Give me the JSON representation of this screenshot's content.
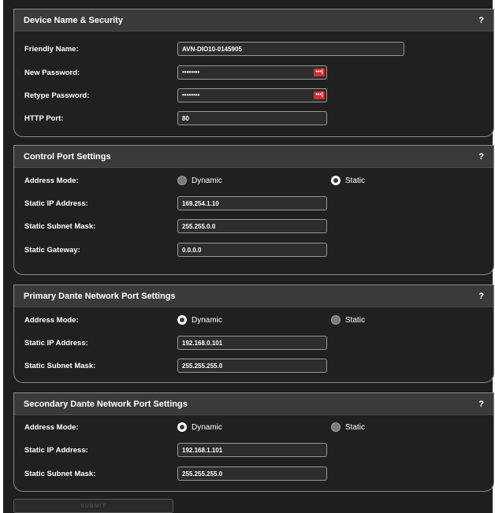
{
  "device": {
    "title": "Device Name & Security",
    "help": "?",
    "friendly_name_label": "Friendly Name:",
    "friendly_name_value": "AVN-DIO10-0145905",
    "new_password_label": "New Password:",
    "new_password_value": "••••••••",
    "retype_password_label": "Retype Password:",
    "retype_password_value": "••••••••",
    "reveal_glyph": "•••|",
    "http_port_label": "HTTP Port:",
    "http_port_value": "80"
  },
  "control": {
    "title": "Control Port Settings",
    "help": "?",
    "address_mode_label": "Address Mode:",
    "dynamic_label": "Dynamic",
    "static_label": "Static",
    "selected_mode": "Static",
    "ip_label": "Static IP Address:",
    "ip_value": "169.254.1.10",
    "mask_label": "Static Subnet Mask:",
    "mask_value": "255.255.0.0",
    "gateway_label": "Static Gateway:",
    "gateway_value": "0.0.0.0"
  },
  "primary": {
    "title": "Primary Dante Network Port Settings",
    "help": "?",
    "address_mode_label": "Address Mode:",
    "dynamic_label": "Dynamic",
    "static_label": "Static",
    "selected_mode": "Dynamic",
    "ip_label": "Static IP Address:",
    "ip_value": "192.168.0.101",
    "mask_label": "Static Subnet Mask:",
    "mask_value": "255.255.255.0"
  },
  "secondary": {
    "title": "Secondary Dante Network Port Settings",
    "help": "?",
    "address_mode_label": "Address Mode:",
    "dynamic_label": "Dynamic",
    "static_label": "Static",
    "selected_mode": "Dynamic",
    "ip_label": "Static IP Address:",
    "ip_value": "192.168.1.101",
    "mask_label": "Static Subnet Mask:",
    "mask_value": "255.255.255.0"
  },
  "submit_label": "SUBMIT",
  "colors": {
    "background": "#1f1f1f",
    "panel_header": "#3a3a3a",
    "reveal_button": "#d32f2f"
  }
}
